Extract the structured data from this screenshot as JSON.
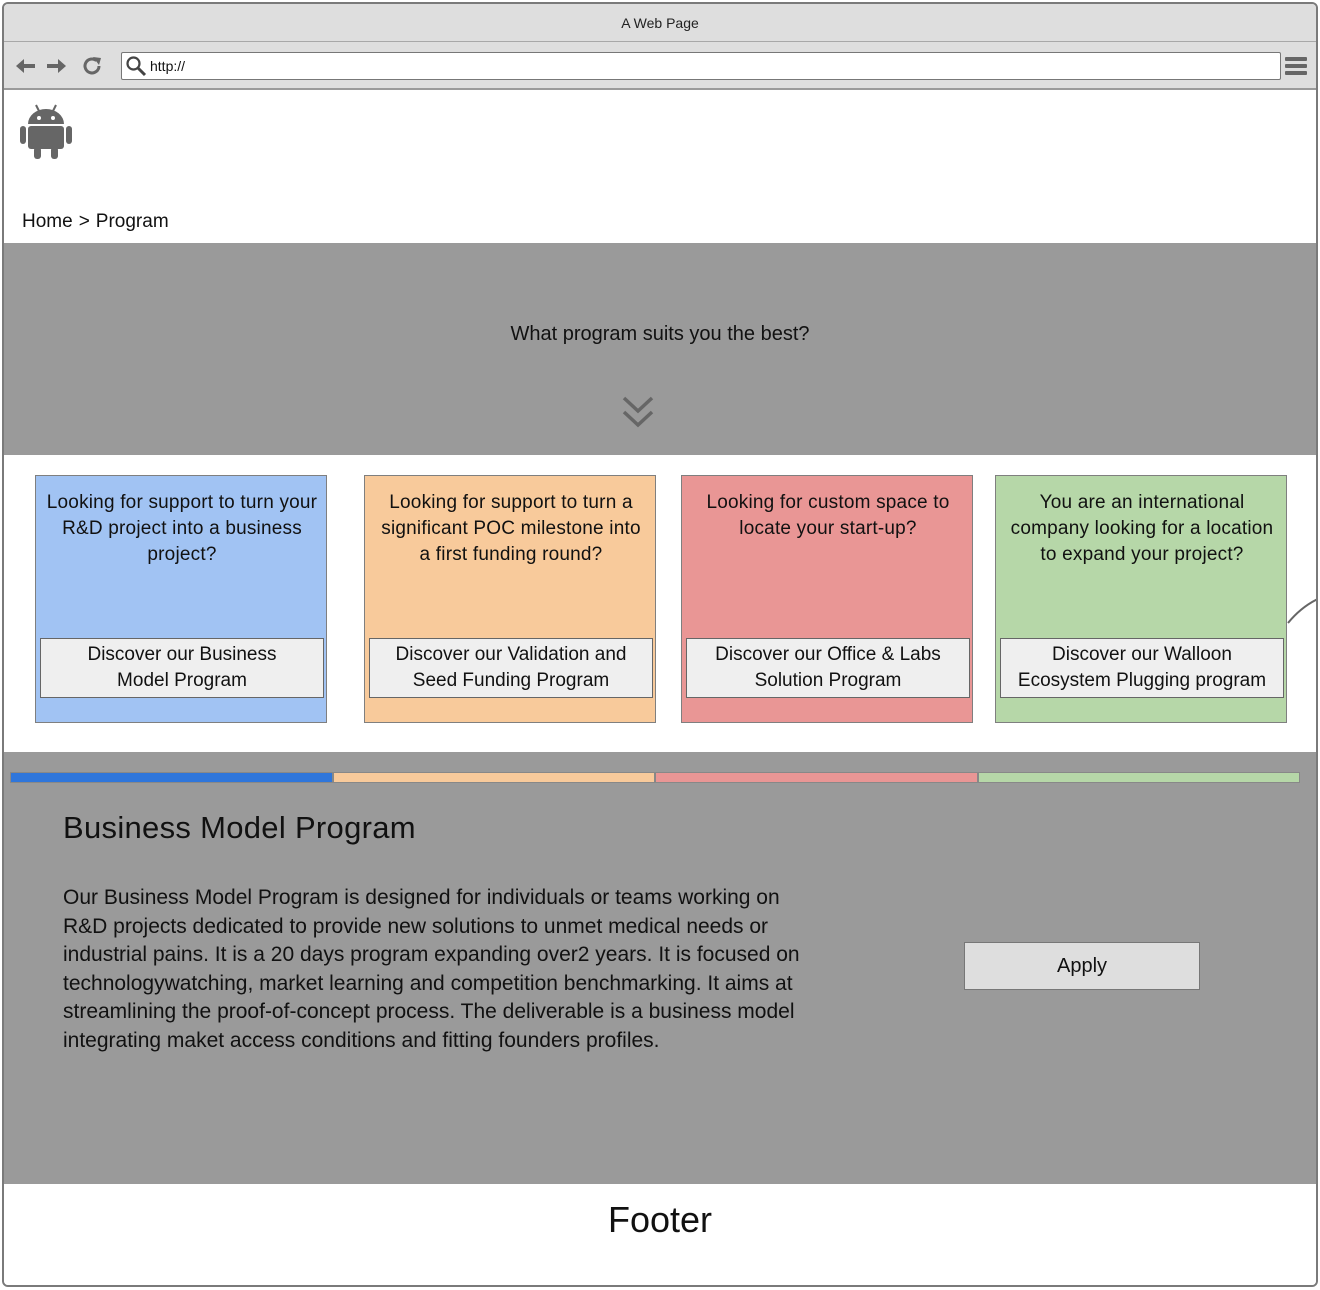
{
  "window": {
    "title": "A Web Page"
  },
  "toolbar": {
    "url": "http://"
  },
  "breadcrumb": {
    "home": "Home",
    "separator": ">",
    "current": "Program"
  },
  "hero": {
    "title": "What program suits you the best?"
  },
  "cards": [
    {
      "question": "Looking for support to turn your R&D project into a business project?",
      "button": "Discover our Business\nModel Program",
      "color": "#a1c3f3"
    },
    {
      "question": "Looking for support to turn a significant POC milestone into a first funding round?",
      "button": "Discover our Validation and\nSeed Funding Program",
      "color": "#f8ca9b"
    },
    {
      "question": "Looking for custom space to locate your start-up?",
      "button": "Discover our Office & Labs\nSolution Program",
      "color": "#e99695"
    },
    {
      "question": "You are an international company looking for a location to expand your project?",
      "button": "Discover our Walloon\nEcosystem Plugging program",
      "color": "#b6d7a8"
    }
  ],
  "tabs": [
    {
      "color": "#2f76db",
      "selected": true
    },
    {
      "color": "#f8ca9b",
      "selected": false
    },
    {
      "color": "#e99695",
      "selected": false
    },
    {
      "color": "#b6d7a8",
      "selected": false
    }
  ],
  "detail": {
    "title": "Business Model Program",
    "body": "Our Business Model Program is designed for individuals or teams working on R&D projects dedicated to provide new solutions to unmet medical needs or industrial pains. It is a 20 days program expanding over2 years. It is focused on technologywatching, market learning and competition benchmarking. It aims at streamlining the proof-of-concept process. The deliverable is a business model integrating maket access conditions and fitting founders profiles.",
    "apply": "Apply"
  },
  "footer": {
    "text": "Footer"
  },
  "icons": {
    "back": "arrow-left-icon",
    "forward": "arrow-right-icon",
    "reload": "reload-icon",
    "search": "search-icon",
    "menu": "hamburger-menu-icon",
    "logo": "android-logo-icon",
    "chevron": "double-chevron-down-icon"
  }
}
